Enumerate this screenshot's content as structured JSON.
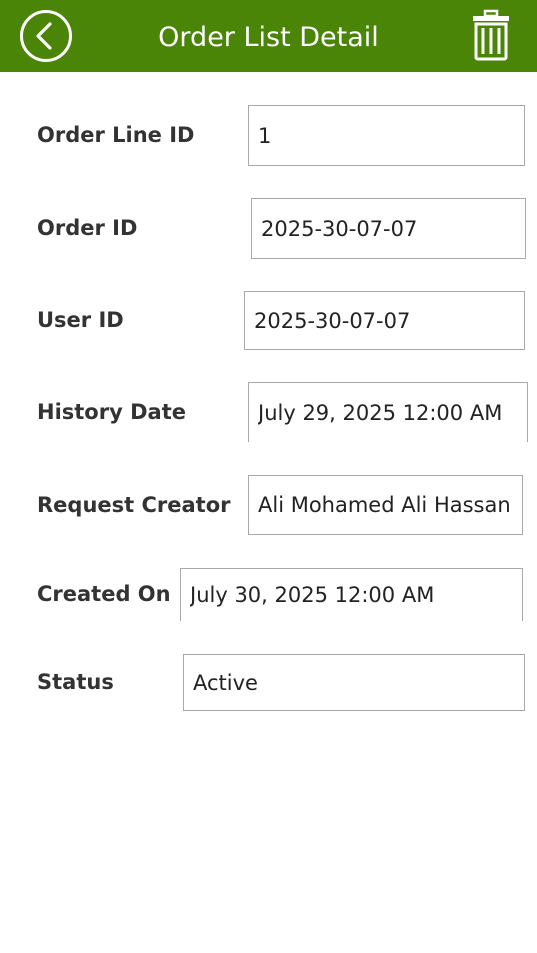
{
  "header": {
    "title": "Order List Detail",
    "background_color": "#4a8507",
    "back_icon": "back-circle-chevron-icon",
    "delete_icon": "trash-icon"
  },
  "form": {
    "order_line_id": {
      "label": "Order Line ID",
      "value": "1"
    },
    "order_id": {
      "label": "Order ID",
      "value": "2025-30-07-07"
    },
    "user_id": {
      "label": "User ID",
      "value": "2025-30-07-07"
    },
    "history_date": {
      "label": "History Date",
      "value": "July 29, 2025 12:00 AM"
    },
    "request_creator": {
      "label": "Request Creator",
      "value": "Ali Mohamed Ali Hassan"
    },
    "created_on": {
      "label": "Created On",
      "value": "July 30, 2025 12:00 AM"
    },
    "status": {
      "label": "Status",
      "value": "Active"
    }
  }
}
